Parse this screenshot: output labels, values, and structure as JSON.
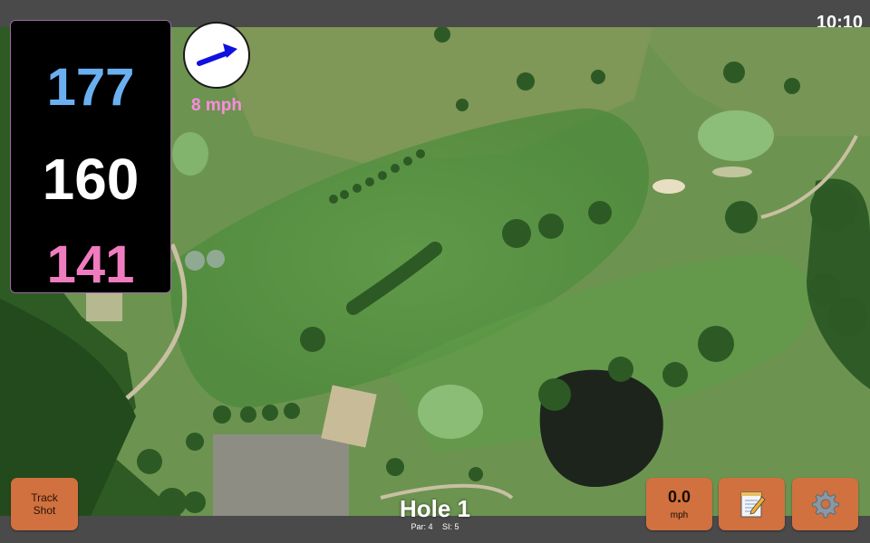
{
  "status_bar": {
    "clock": "10:10"
  },
  "distances": {
    "back": "177",
    "middle": "160",
    "front": "141"
  },
  "wind": {
    "speed": "8 mph",
    "icon": "wind-arrow-icon",
    "arrow_color": "#1010e0"
  },
  "buttons": {
    "track_shot_line1": "Track",
    "track_shot_line2": "Shot",
    "speed_value": "0.0",
    "speed_unit": "mph",
    "notes_icon": "notepad-icon",
    "settings_icon": "gear-icon"
  },
  "hole": {
    "title": "Hole 1",
    "par": "Par: 4",
    "si": "SI: 5"
  },
  "colors": {
    "back_distance": "#6ab0f0",
    "middle_distance": "#ffffff",
    "front_distance": "#f07cc0",
    "wind_text": "#ff8adf",
    "button_bg": "#d0713f",
    "bar_bg": "#4a4a4a"
  }
}
